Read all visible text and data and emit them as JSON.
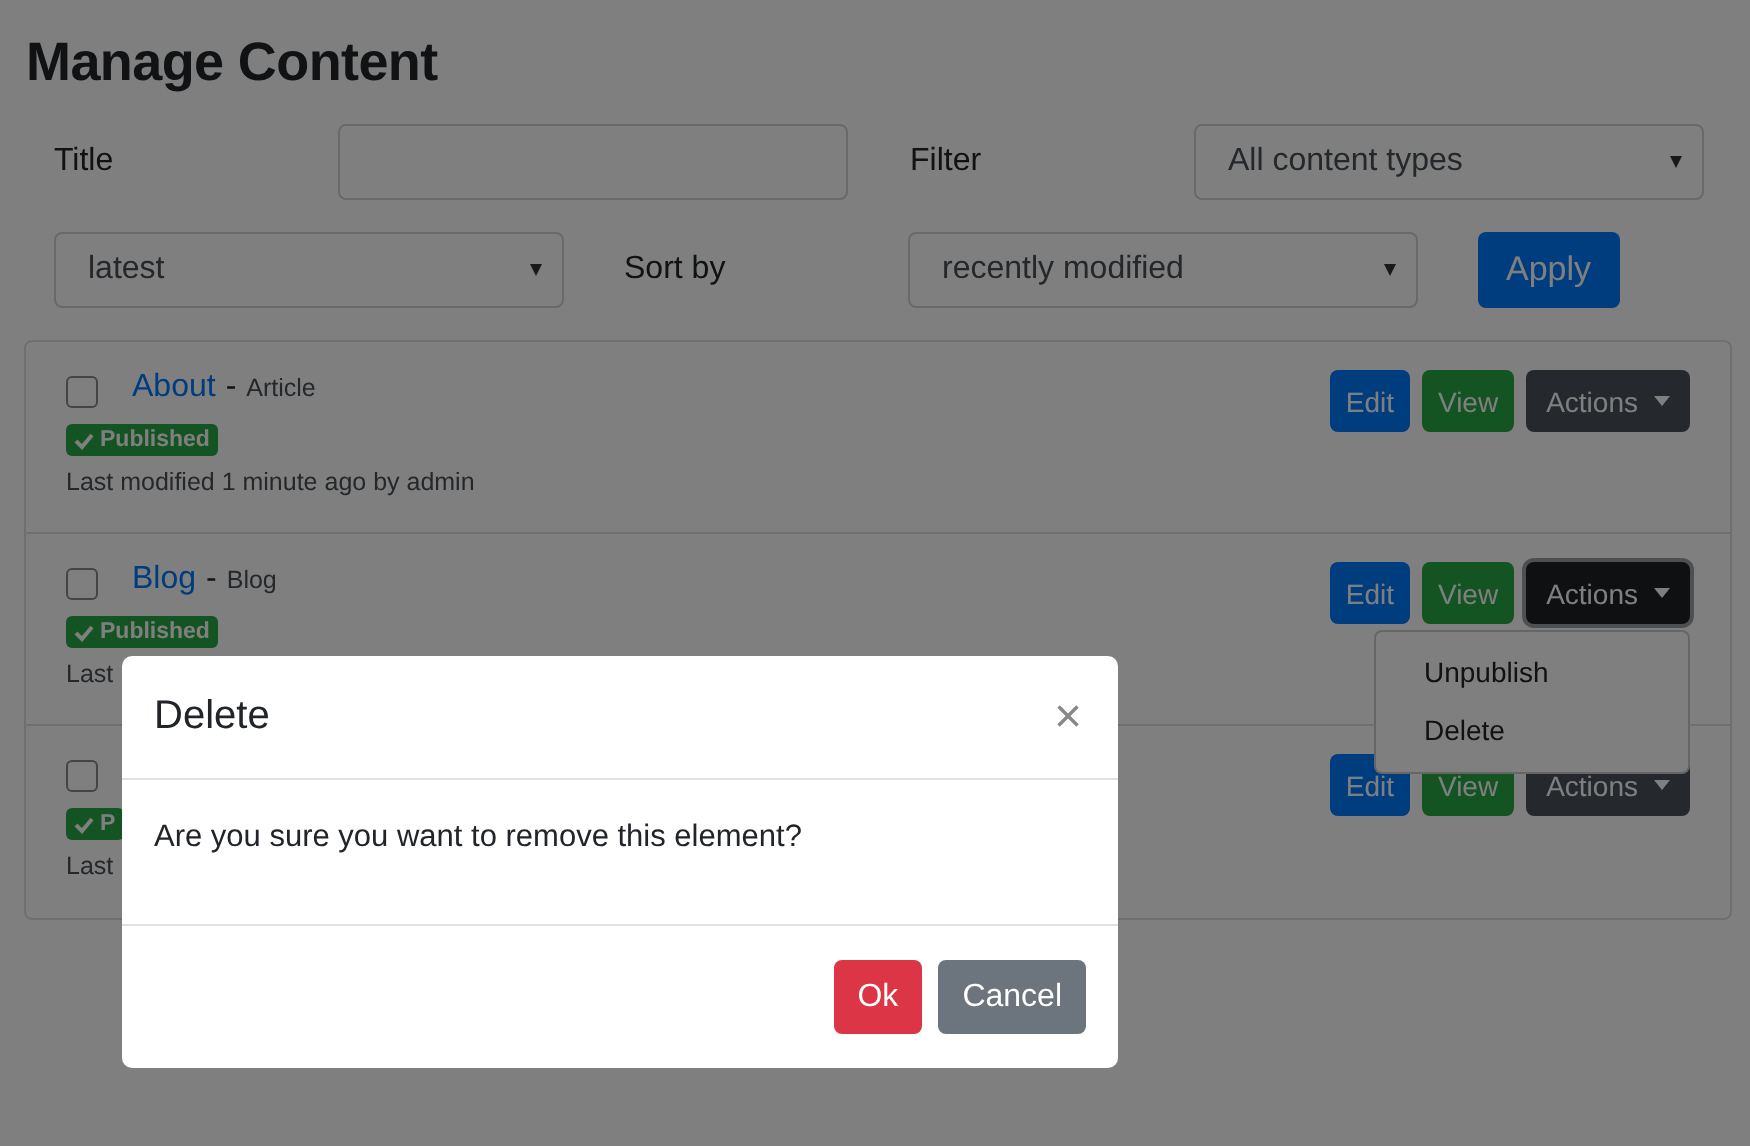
{
  "page": {
    "title": "Manage Content"
  },
  "filters": {
    "title_label": "Title",
    "filter_label": "Filter",
    "filter_value": "All content types",
    "order_value": "latest",
    "sort_label": "Sort by",
    "sort_value": "recently modified",
    "apply": "Apply"
  },
  "items": [
    {
      "title": "About",
      "separator": "-",
      "type": "Article",
      "checked": false,
      "status": "Published",
      "meta": "Last modified 1 minute ago by admin",
      "edit": "Edit",
      "view": "View",
      "actions": "Actions",
      "menu_open": false
    },
    {
      "title": "Blog",
      "separator": "-",
      "type": "Blog",
      "checked": false,
      "status": "Published",
      "meta": "Last",
      "edit": "Edit",
      "view": "View",
      "actions": "Actions",
      "menu_open": true
    },
    {
      "checked": false,
      "status": "P",
      "meta": "Last",
      "edit": "Edit",
      "view": "View",
      "actions": "Actions",
      "menu_open": false
    }
  ],
  "dropdown": {
    "items": [
      "Unpublish",
      "Delete"
    ]
  },
  "modal": {
    "title": "Delete",
    "close": "×",
    "message": "Are you sure you want to remove this element?",
    "ok": "Ok",
    "cancel": "Cancel"
  }
}
